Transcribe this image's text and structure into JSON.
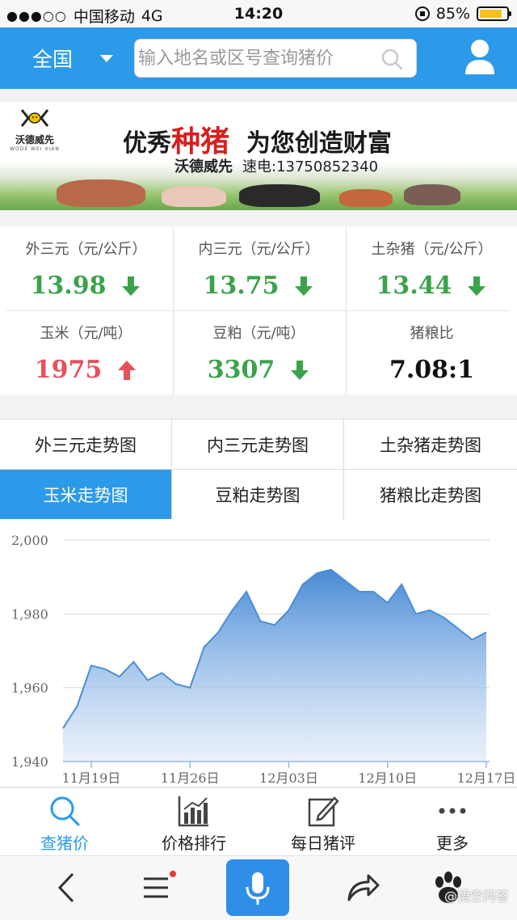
{
  "status_bar": {
    "carrier": "中国移动",
    "network": "4G",
    "time": "14:20",
    "battery_pct": "85%",
    "battery_level": 0.85
  },
  "header": {
    "region": "全国",
    "search_placeholder": "输入地名或区号查询猪价"
  },
  "banner": {
    "logo_text": "沃德威先",
    "logo_sub": "WODE WEI XIAN",
    "slogan_prefix": "优秀",
    "slogan_highlight": "种猪",
    "slogan_suffix": "为您创造财富",
    "brand": "沃德威先",
    "phone_label": "速电:13750852340"
  },
  "prices": [
    {
      "label": "外三元（元/公斤）",
      "value": "13.98",
      "trend": "down"
    },
    {
      "label": "内三元（元/公斤）",
      "value": "13.75",
      "trend": "down"
    },
    {
      "label": "土杂猪（元/公斤）",
      "value": "13.44",
      "trend": "down"
    },
    {
      "label": "玉米（元/吨）",
      "value": "1975",
      "trend": "up"
    },
    {
      "label": "豆粕（元/吨）",
      "value": "3307",
      "trend": "down"
    },
    {
      "label": "猪粮比",
      "value": "7.08:1",
      "trend": "none"
    }
  ],
  "tabs": [
    {
      "label": "外三元走势图",
      "active": false
    },
    {
      "label": "内三元走势图",
      "active": false
    },
    {
      "label": "土杂猪走势图",
      "active": false
    },
    {
      "label": "玉米走势图",
      "active": true
    },
    {
      "label": "豆粕走势图",
      "active": false
    },
    {
      "label": "猪粮比走势图",
      "active": false
    }
  ],
  "chart_data": {
    "type": "area",
    "title": "",
    "xlabel": "",
    "ylabel": "",
    "ylim": [
      1940,
      2000
    ],
    "yticks": [
      "1,940",
      "1,960",
      "1,980",
      "2,000"
    ],
    "xticks": [
      "11月19日",
      "11月26日",
      "12月03日",
      "12月10日",
      "12月17日"
    ],
    "grid": true,
    "color": "#4a8fd6",
    "x": [
      "11月17日",
      "11月18日",
      "11月19日",
      "11月20日",
      "11月21日",
      "11月22日",
      "11月23日",
      "11月24日",
      "11月25日",
      "11月26日",
      "11月27日",
      "11月28日",
      "11月29日",
      "11月30日",
      "12月01日",
      "12月02日",
      "12月03日",
      "12月04日",
      "12月05日",
      "12月06日",
      "12月07日",
      "12月08日",
      "12月09日",
      "12月10日",
      "12月11日",
      "12月12日",
      "12月13日",
      "12月14日",
      "12月15日",
      "12月16日",
      "12月17日"
    ],
    "values": [
      1949,
      1955,
      1966,
      1965,
      1963,
      1967,
      1962,
      1964,
      1961,
      1960,
      1971,
      1975,
      1981,
      1986,
      1978,
      1977,
      1981,
      1988,
      1991,
      1992,
      1989,
      1986,
      1986,
      1983,
      1988,
      1980,
      1981,
      1979,
      1976,
      1973,
      1975
    ]
  },
  "bottom_nav": [
    {
      "label": "查猪价",
      "icon": "search-icon",
      "active": true
    },
    {
      "label": "价格排行",
      "icon": "bar-chart-icon",
      "active": false
    },
    {
      "label": "每日猪评",
      "icon": "edit-icon",
      "active": false
    },
    {
      "label": "更多",
      "icon": "more-icon",
      "active": false
    }
  ],
  "browser_bar": {
    "watermark": "@悟空问答"
  },
  "colors": {
    "primary": "#2c9ae8",
    "down": "#3aa34a",
    "up": "#e8505b"
  }
}
